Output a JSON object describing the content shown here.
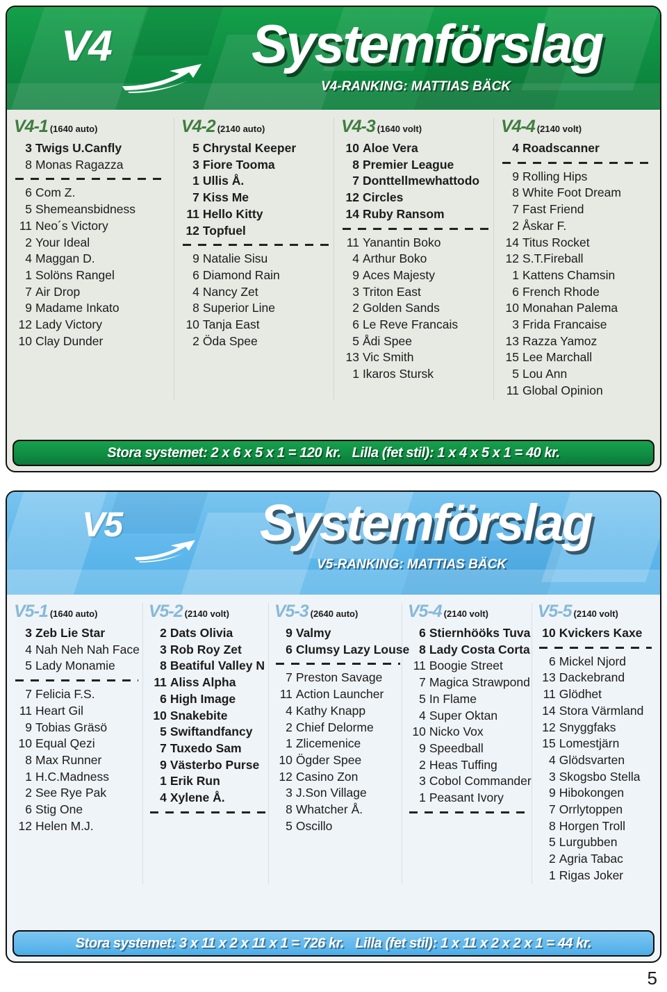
{
  "page_number": "5",
  "colors": {
    "v4_accent": "#0f8f43",
    "v5_accent": "#4fb0e8",
    "v4_head_color": "#3f7d3f",
    "v5_head_color": "#86b9d8"
  },
  "v4": {
    "logo": "V4",
    "title": "Systemförslag",
    "subtitle": "V4-RANKING: MATTIAS BÄCK",
    "columns": [
      {
        "name": "V4-1",
        "distance": "(1640 auto)",
        "entries": [
          {
            "num": "3",
            "horse": "Twigs U.Canfly",
            "bold": true
          },
          {
            "num": "8",
            "horse": "Monas Ragazza",
            "bold": false
          },
          {
            "sep": true
          },
          {
            "num": "6",
            "horse": "Com Z.",
            "bold": false
          },
          {
            "num": "5",
            "horse": "Shemeansbidness",
            "bold": false
          },
          {
            "num": "11",
            "horse": "Neo´s Victory",
            "bold": false
          },
          {
            "num": "2",
            "horse": "Your Ideal",
            "bold": false
          },
          {
            "num": "4",
            "horse": "Maggan D.",
            "bold": false
          },
          {
            "num": "1",
            "horse": "Solöns Rangel",
            "bold": false
          },
          {
            "num": "7",
            "horse": "Air Drop",
            "bold": false
          },
          {
            "num": "9",
            "horse": "Madame Inkato",
            "bold": false
          },
          {
            "num": "12",
            "horse": "Lady Victory",
            "bold": false
          },
          {
            "num": "10",
            "horse": "Clay Dunder",
            "bold": false
          }
        ]
      },
      {
        "name": "V4-2",
        "distance": "(2140 auto)",
        "entries": [
          {
            "num": "5",
            "horse": "Chrystal Keeper",
            "bold": true
          },
          {
            "num": "3",
            "horse": "Fiore Tooma",
            "bold": true
          },
          {
            "num": "1",
            "horse": "Ullis Å.",
            "bold": true
          },
          {
            "num": "7",
            "horse": "Kiss Me",
            "bold": true
          },
          {
            "num": "11",
            "horse": "Hello Kitty",
            "bold": true
          },
          {
            "num": "12",
            "horse": "Topfuel",
            "bold": true
          },
          {
            "sep": true
          },
          {
            "num": "9",
            "horse": "Natalie Sisu",
            "bold": false
          },
          {
            "num": "6",
            "horse": "Diamond Rain",
            "bold": false
          },
          {
            "num": "4",
            "horse": "Nancy Zet",
            "bold": false
          },
          {
            "num": "8",
            "horse": "Superior Line",
            "bold": false
          },
          {
            "num": "10",
            "horse": "Tanja East",
            "bold": false
          },
          {
            "num": "2",
            "horse": "Öda Spee",
            "bold": false
          }
        ]
      },
      {
        "name": "V4-3",
        "distance": "(1640 volt)",
        "entries": [
          {
            "num": "10",
            "horse": "Aloe Vera",
            "bold": true
          },
          {
            "num": "8",
            "horse": "Premier League",
            "bold": true
          },
          {
            "num": "7",
            "horse": "Donttellmewhattodo",
            "bold": true
          },
          {
            "num": "12",
            "horse": "Circles",
            "bold": true
          },
          {
            "num": "14",
            "horse": "Ruby Ransom",
            "bold": true
          },
          {
            "sep": true
          },
          {
            "num": "11",
            "horse": "Yanantin Boko",
            "bold": false
          },
          {
            "num": "4",
            "horse": "Arthur Boko",
            "bold": false
          },
          {
            "num": "9",
            "horse": "Aces Majesty",
            "bold": false
          },
          {
            "num": "3",
            "horse": "Triton East",
            "bold": false
          },
          {
            "num": "2",
            "horse": "Golden Sands",
            "bold": false
          },
          {
            "num": "6",
            "horse": "Le Reve Francais",
            "bold": false
          },
          {
            "num": "5",
            "horse": "Ådi Spee",
            "bold": false
          },
          {
            "num": "13",
            "horse": "Vic Smith",
            "bold": false
          },
          {
            "num": "1",
            "horse": "Ikaros Stursk",
            "bold": false
          }
        ]
      },
      {
        "name": "V4-4",
        "distance": "(2140 volt)",
        "entries": [
          {
            "num": "4",
            "horse": "Roadscanner",
            "bold": true
          },
          {
            "sep": true
          },
          {
            "num": "9",
            "horse": "Rolling Hips",
            "bold": false
          },
          {
            "num": "8",
            "horse": "White Foot Dream",
            "bold": false
          },
          {
            "num": "7",
            "horse": "Fast Friend",
            "bold": false
          },
          {
            "num": "2",
            "horse": "Åskar F.",
            "bold": false
          },
          {
            "num": "14",
            "horse": "Titus Rocket",
            "bold": false
          },
          {
            "num": "12",
            "horse": "S.T.Fireball",
            "bold": false
          },
          {
            "num": "1",
            "horse": "Kattens Chamsin",
            "bold": false
          },
          {
            "num": "6",
            "horse": "French Rhode",
            "bold": false
          },
          {
            "num": "10",
            "horse": "Monahan Palema",
            "bold": false
          },
          {
            "num": "3",
            "horse": "Frida Francaise",
            "bold": false
          },
          {
            "num": "13",
            "horse": "Razza Yamoz",
            "bold": false
          },
          {
            "num": "15",
            "horse": "Lee Marchall",
            "bold": false
          },
          {
            "num": "5",
            "horse": "Lou Ann",
            "bold": false
          },
          {
            "num": "11",
            "horse": "Global Opinion",
            "bold": false
          }
        ]
      }
    ],
    "footer_large": "Stora systemet: 2 x 6 x 5 x 1 = 120 kr.",
    "footer_small": "Lilla (fet stil): 1 x 4 x 5 x 1 = 40 kr."
  },
  "v5": {
    "logo": "V5",
    "title": "Systemförslag",
    "subtitle": "V5-RANKING: MATTIAS BÄCK",
    "columns": [
      {
        "name": "V5-1",
        "distance": "(1640 auto)",
        "entries": [
          {
            "num": "3",
            "horse": "Zeb Lie Star",
            "bold": true
          },
          {
            "num": "4",
            "horse": "Nah Neh Nah Face",
            "bold": false
          },
          {
            "num": "5",
            "horse": "Lady Monamie",
            "bold": false
          },
          {
            "sep": true
          },
          {
            "num": "7",
            "horse": "Felicia F.S.",
            "bold": false
          },
          {
            "num": "11",
            "horse": "Heart Gil",
            "bold": false
          },
          {
            "num": "9",
            "horse": "Tobias Gräsö",
            "bold": false
          },
          {
            "num": "10",
            "horse": "Equal Qezi",
            "bold": false
          },
          {
            "num": "8",
            "horse": "Max Runner",
            "bold": false
          },
          {
            "num": "1",
            "horse": "H.C.Madness",
            "bold": false
          },
          {
            "num": "2",
            "horse": "See Rye Pak",
            "bold": false
          },
          {
            "num": "6",
            "horse": "Stig One",
            "bold": false
          },
          {
            "num": "12",
            "horse": "Helen M.J.",
            "bold": false
          }
        ]
      },
      {
        "name": "V5-2",
        "distance": "(2140 volt)",
        "entries": [
          {
            "num": "2",
            "horse": "Dats Olivia",
            "bold": true
          },
          {
            "num": "3",
            "horse": "Rob Roy Zet",
            "bold": true
          },
          {
            "num": "8",
            "horse": "Beatiful Valley N",
            "bold": true
          },
          {
            "num": "11",
            "horse": "Aliss Alpha",
            "bold": true
          },
          {
            "num": "6",
            "horse": "High Image",
            "bold": true
          },
          {
            "num": "10",
            "horse": "Snakebite",
            "bold": true
          },
          {
            "num": "5",
            "horse": "Swiftandfancy",
            "bold": true
          },
          {
            "num": "7",
            "horse": "Tuxedo Sam",
            "bold": true
          },
          {
            "num": "9",
            "horse": "Västerbo Purse",
            "bold": true
          },
          {
            "num": "1",
            "horse": "Erik Run",
            "bold": true
          },
          {
            "num": "4",
            "horse": "Xylene Å.",
            "bold": true
          },
          {
            "sep": true
          }
        ]
      },
      {
        "name": "V5-3",
        "distance": "(2640 auto)",
        "entries": [
          {
            "num": "9",
            "horse": "Valmy",
            "bold": true
          },
          {
            "num": "6",
            "horse": "Clumsy Lazy Louse",
            "bold": true
          },
          {
            "sep": true
          },
          {
            "num": "7",
            "horse": "Preston Savage",
            "bold": false
          },
          {
            "num": "11",
            "horse": "Action Launcher",
            "bold": false
          },
          {
            "num": "4",
            "horse": "Kathy Knapp",
            "bold": false
          },
          {
            "num": "2",
            "horse": "Chief Delorme",
            "bold": false
          },
          {
            "num": "1",
            "horse": "Zlicemenice",
            "bold": false
          },
          {
            "num": "10",
            "horse": "Ögder Spee",
            "bold": false
          },
          {
            "num": "12",
            "horse": "Casino Zon",
            "bold": false
          },
          {
            "num": "3",
            "horse": "J.Son Village",
            "bold": false
          },
          {
            "num": "8",
            "horse": "Whatcher Å.",
            "bold": false
          },
          {
            "num": "5",
            "horse": "Oscillo",
            "bold": false
          }
        ]
      },
      {
        "name": "V5-4",
        "distance": "(2140 volt)",
        "entries": [
          {
            "num": "6",
            "horse": "Stiernhööks Tuva",
            "bold": true
          },
          {
            "num": "8",
            "horse": "Lady Costa Corta",
            "bold": true
          },
          {
            "num": "11",
            "horse": "Boogie Street",
            "bold": false
          },
          {
            "num": "7",
            "horse": "Magica Strawpond",
            "bold": false
          },
          {
            "num": "5",
            "horse": "In Flame",
            "bold": false
          },
          {
            "num": "4",
            "horse": "Super Oktan",
            "bold": false
          },
          {
            "num": "10",
            "horse": "Nicko Vox",
            "bold": false
          },
          {
            "num": "9",
            "horse": "Speedball",
            "bold": false
          },
          {
            "num": "2",
            "horse": "Heas Tuffing",
            "bold": false
          },
          {
            "num": "3",
            "horse": "Cobol Commander",
            "bold": false
          },
          {
            "num": "1",
            "horse": "Peasant Ivory",
            "bold": false
          },
          {
            "sep": true
          }
        ]
      },
      {
        "name": "V5-5",
        "distance": "(2140 volt)",
        "entries": [
          {
            "num": "10",
            "horse": "Kvickers Kaxe",
            "bold": true
          },
          {
            "sep": true
          },
          {
            "num": "6",
            "horse": "Mickel Njord",
            "bold": false
          },
          {
            "num": "13",
            "horse": "Dackebrand",
            "bold": false
          },
          {
            "num": "11",
            "horse": "Glödhet",
            "bold": false
          },
          {
            "num": "14",
            "horse": "Stora Värmland",
            "bold": false
          },
          {
            "num": "12",
            "horse": "Snyggfaks",
            "bold": false
          },
          {
            "num": "15",
            "horse": "Lomestjärn",
            "bold": false
          },
          {
            "num": "4",
            "horse": "Glödsvarten",
            "bold": false
          },
          {
            "num": "3",
            "horse": "Skogsbo Stella",
            "bold": false
          },
          {
            "num": "9",
            "horse": "Hibokongen",
            "bold": false
          },
          {
            "num": "7",
            "horse": "Orrlytoppen",
            "bold": false
          },
          {
            "num": "8",
            "horse": "Horgen Troll",
            "bold": false
          },
          {
            "num": "5",
            "horse": "Lurgubben",
            "bold": false
          },
          {
            "num": "2",
            "horse": "Agria Tabac",
            "bold": false
          },
          {
            "num": "1",
            "horse": "Rigas Joker",
            "bold": false
          }
        ]
      }
    ],
    "footer_large": "Stora systemet: 3 x 11 x 2 x 11 x 1 = 726 kr.",
    "footer_small": "Lilla (fet stil): 1 x 11 x 2 x 2 x 1 = 44 kr."
  }
}
